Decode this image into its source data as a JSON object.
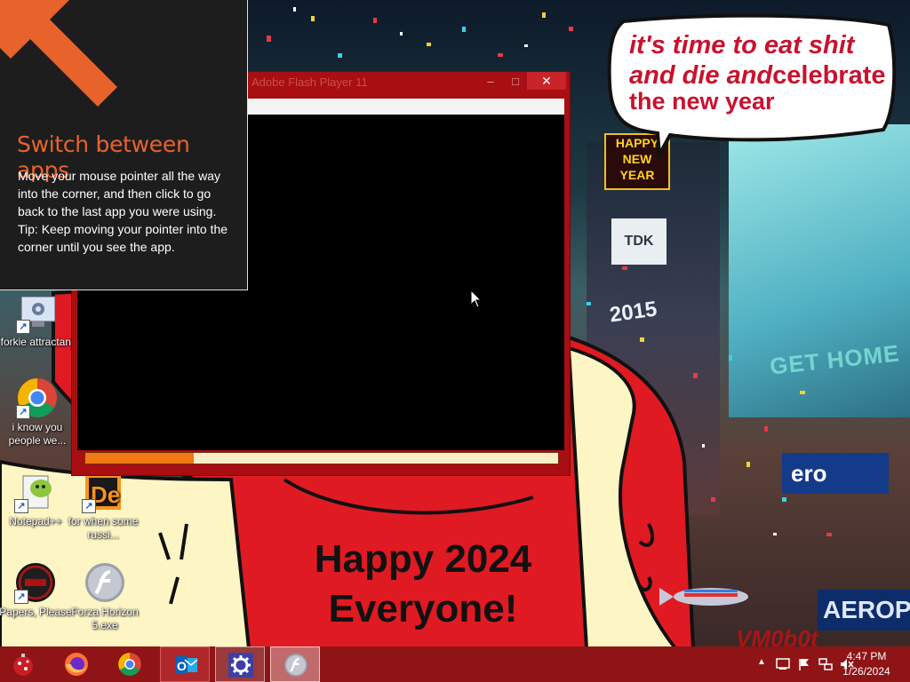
{
  "wallpaper": {
    "bubble": {
      "line1": "it's time to eat shit",
      "line2a": "and die and",
      "line2b": "celebrate",
      "line3": "the new year"
    },
    "sign_happy_new_year": [
      "HAPPY",
      "NEW",
      "YEAR"
    ],
    "sign_tdk": "TDK",
    "sign_2015": "2015",
    "sign_get_home": "GET HOME",
    "sign_aero_top": "ero",
    "sign_aero_bottom": "AEROP",
    "happy_text_line1": "Happy 2024",
    "happy_text_line2": "Everyone!",
    "watermark": "VM0b0t"
  },
  "desktop_icons": [
    {
      "id": "forkie",
      "label": "forkie attractant",
      "icon": "settings-shortcut-icon"
    },
    {
      "id": "chrome",
      "label": "i know you people we...",
      "icon": "chrome-icon"
    },
    {
      "id": "notepadpp",
      "label": "Notepad++",
      "icon": "notepadpp-icon"
    },
    {
      "id": "russian",
      "label": "for when some russi...",
      "icon": "de-icon"
    },
    {
      "id": "papers",
      "label": "Papers, Please",
      "icon": "papers-please-icon"
    },
    {
      "id": "forza",
      "label": "Forza Horizon 5.exe",
      "icon": "flash-player-icon"
    }
  ],
  "shortcut_arrow": "↗",
  "dialog": {
    "title": "Adobe Flash Player 11",
    "minimize": "–",
    "maximize": "□",
    "close": "✕",
    "progress_fraction": 0.23
  },
  "tip": {
    "heading": "Switch between apps",
    "body_line1": "Move your mouse pointer all the way into the corner, and then click to go back to the last app you were using.",
    "body_line2": "Tip: Keep moving your pointer into the corner until you see the app."
  },
  "taskbar": {
    "start": "start-ornament-icon",
    "apps": [
      {
        "id": "firefox",
        "icon": "firefox-icon"
      },
      {
        "id": "chrome",
        "icon": "chrome-icon"
      },
      {
        "id": "outlook",
        "icon": "outlook-icon"
      },
      {
        "id": "settings",
        "icon": "settings-gear-icon"
      },
      {
        "id": "flash",
        "icon": "flash-player-icon"
      }
    ],
    "tray": {
      "overflow": "▲",
      "time": "4:47 PM",
      "date": "1/26/2024"
    }
  },
  "colors": {
    "accent_orange": "#e8632b",
    "taskbar": "#8e1416",
    "dialog_frame": "#a80e12",
    "progress_fill": "#ef7a12",
    "bubble_text": "#c8122e"
  }
}
